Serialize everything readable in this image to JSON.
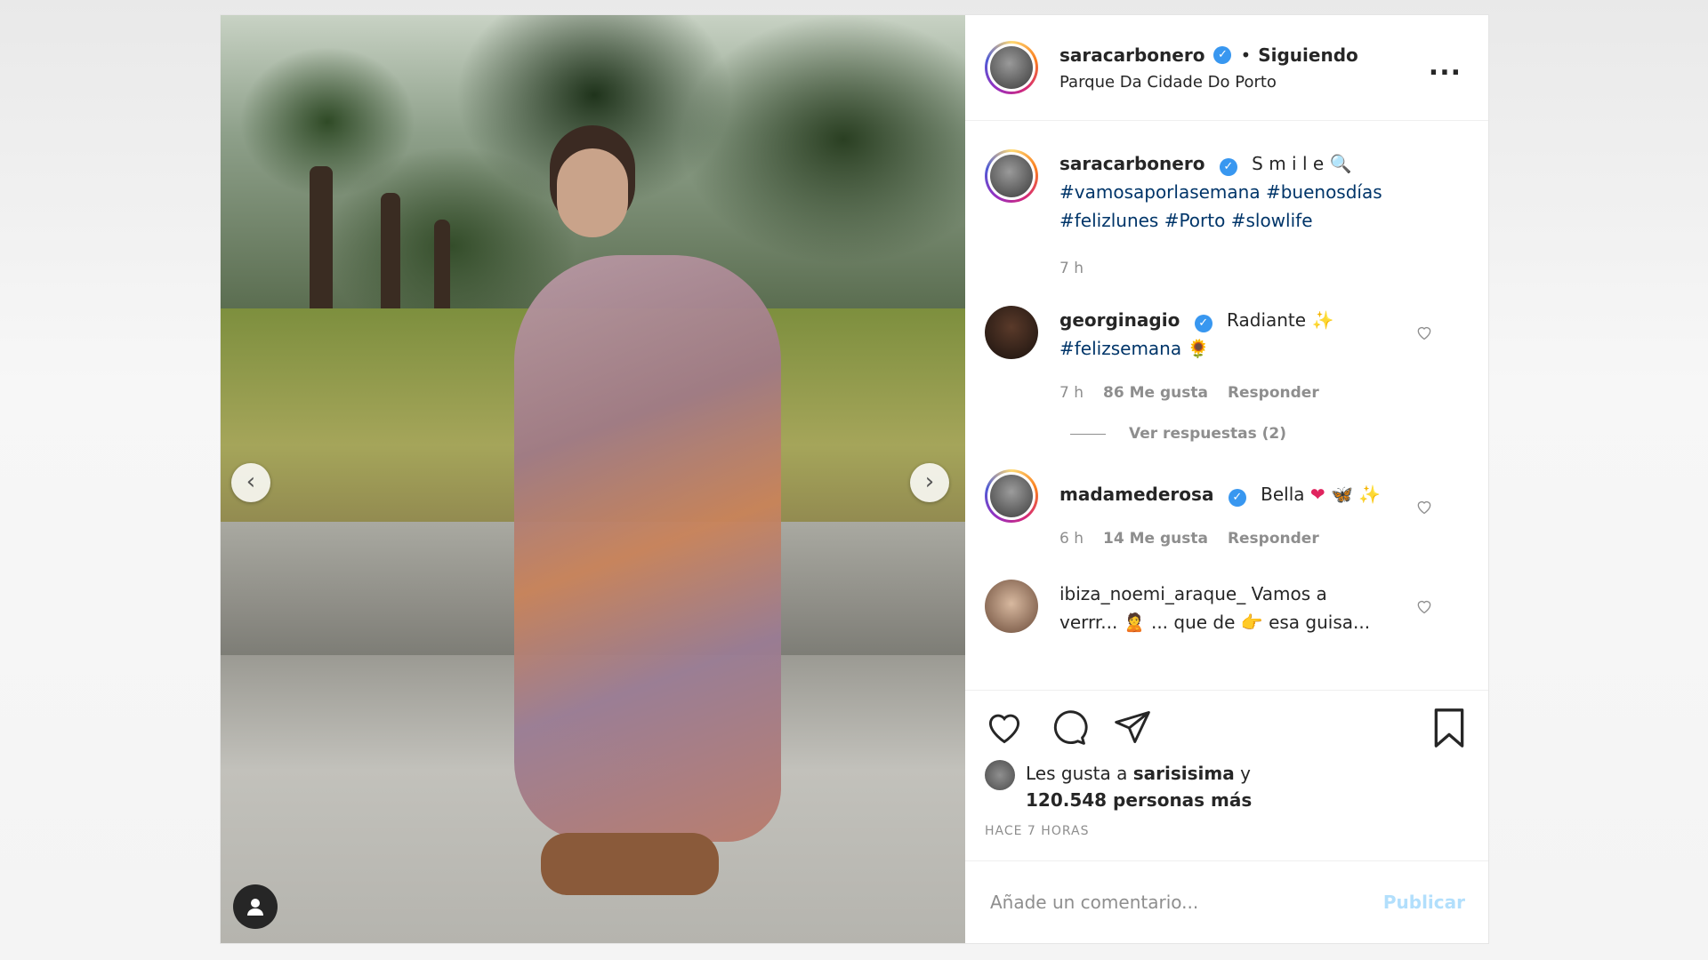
{
  "post": {
    "username": "saracarbonero",
    "following_label": "Siguiendo",
    "separator": "•",
    "location": "Parque Da Cidade Do Porto",
    "more": "..."
  },
  "caption": {
    "username": "saracarbonero",
    "text": "S m i l e",
    "hashtags_line1": "#vamosaporlasemana #buenosdías",
    "hashtags_line2": "#felizlunes #Porto #slowlife",
    "time": "7 h"
  },
  "comments": [
    {
      "username": "georginagio",
      "text": "Radiante",
      "hashtag": "#felizsemana",
      "time": "7 h",
      "likes": "86 Me gusta",
      "reply": "Responder",
      "view_replies": "Ver respuestas (2)"
    },
    {
      "username": "madamederosa",
      "text": "Bella",
      "time": "6 h",
      "likes": "14 Me gusta",
      "reply": "Responder"
    },
    {
      "username": "ibiza_noemi_araque_",
      "text": "Vamos a",
      "text2a": "verrr...",
      "text2b": "... que de",
      "text2c": "esa guisa..."
    }
  ],
  "likes": {
    "prefix": "Les gusta a",
    "user": "sarisisima",
    "conj": "y",
    "count": "120.548 personas más"
  },
  "time_ago": "HACE 7 HORAS",
  "add_comment": {
    "placeholder": "Añade un comentario...",
    "publish": "Publicar"
  },
  "colors": {
    "accent_blue": "#3897f0",
    "hashtag": "#003569",
    "publish_disabled": "#b2dffc"
  }
}
